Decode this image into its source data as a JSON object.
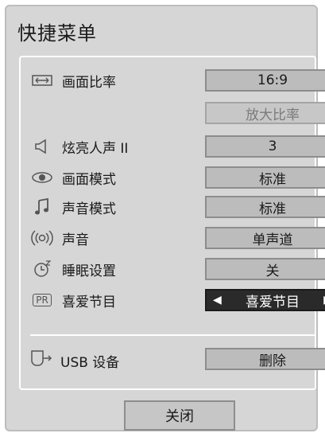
{
  "title": "快捷菜单",
  "rows": [
    {
      "label": "画面比率",
      "value": "16:9",
      "icon": "aspect-ratio-icon"
    },
    {
      "label": "",
      "value": "放大比率",
      "icon": ""
    },
    {
      "label": "炫亮人声 II",
      "value": "3",
      "icon": "speaker-icon"
    },
    {
      "label": "画面模式",
      "value": "标准",
      "icon": "eye-icon"
    },
    {
      "label": "声音模式",
      "value": "标准",
      "icon": "music-note-icon"
    },
    {
      "label": "声音",
      "value": "单声道",
      "icon": "sound-wave-icon"
    },
    {
      "label": "睡眠设置",
      "value": "关",
      "icon": "sleep-timer-icon"
    },
    {
      "label": "喜爱节目",
      "value": "喜爱节目",
      "icon": "pr-icon"
    }
  ],
  "usb": {
    "label": "USB 设备",
    "button": "删除",
    "icon": "usb-icon"
  },
  "pr_badge": "PR",
  "close_button": "关闭"
}
